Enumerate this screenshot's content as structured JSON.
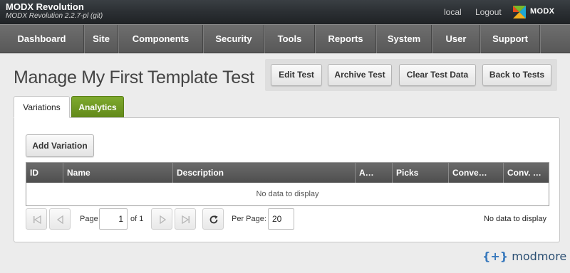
{
  "header": {
    "app_title": "MODX Revolution",
    "app_version": "MODX Revolution 2.2.7-pl (git)",
    "link_local": "local",
    "link_logout": "Logout",
    "logo_text": "MODX"
  },
  "nav": {
    "items": [
      {
        "label": "Dashboard"
      },
      {
        "label": "Site"
      },
      {
        "label": "Components"
      },
      {
        "label": "Security"
      },
      {
        "label": "Tools"
      },
      {
        "label": "Reports"
      },
      {
        "label": "System"
      },
      {
        "label": "User"
      },
      {
        "label": "Support"
      }
    ]
  },
  "page": {
    "title": "Manage My First Template Test",
    "actions": {
      "edit": "Edit Test",
      "archive": "Archive Test",
      "clear": "Clear Test Data",
      "back": "Back to Tests"
    }
  },
  "tabs": [
    {
      "label": "Variations",
      "active": true
    },
    {
      "label": "Analytics",
      "active": false
    }
  ],
  "variations": {
    "add_button": "Add Variation",
    "grid": {
      "columns": [
        "ID",
        "Name",
        "Description",
        "A…",
        "Picks",
        "Conve…",
        "Conv. …"
      ],
      "empty_text": "No data to display"
    },
    "pager": {
      "page_label": "Page",
      "page_value": "1",
      "of_label": "of 1",
      "per_page_label": "Per Page:",
      "per_page_value": "20",
      "status": "No data to display"
    }
  },
  "footer": {
    "brand_brace": "{+}",
    "brand_name": "modmore"
  },
  "colors": {
    "header_bg": "#2b2f33",
    "nav_bg": "#5f5f5f",
    "analytics_tab": "#6f961f",
    "modmore_blue": "#2b4f73"
  }
}
